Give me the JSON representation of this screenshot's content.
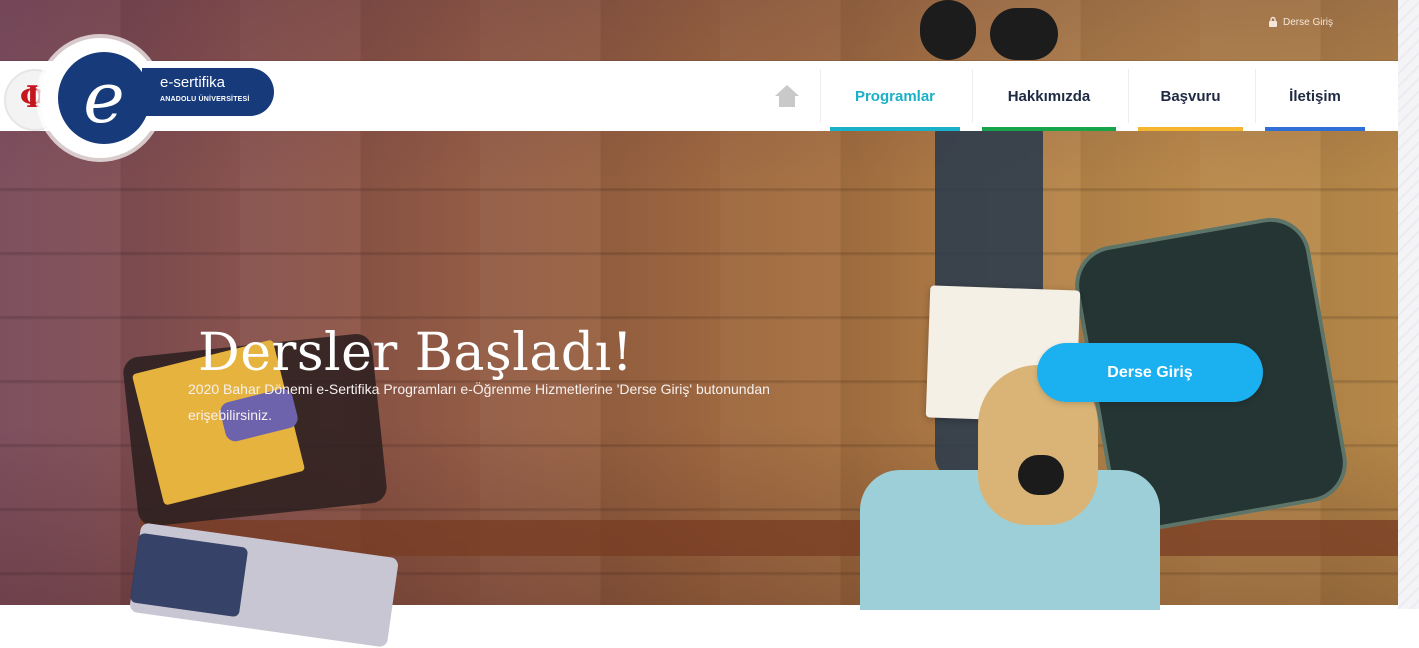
{
  "header": {
    "login_link": "Derse Giriş"
  },
  "logo": {
    "mark": "Φ",
    "letter": "e",
    "title": "e-sertifika",
    "subtitle": "ANADOLU ÜNİVERSİTESİ"
  },
  "nav": {
    "home_icon": "home-icon",
    "items": [
      {
        "label": "Programlar",
        "color": "#1ab0c7"
      },
      {
        "label": "Hakkımızda",
        "color": "#16a34a"
      },
      {
        "label": "Başvuru",
        "color": "#f6b52e"
      },
      {
        "label": "İletişim",
        "color": "#2f6fd6"
      }
    ]
  },
  "hero": {
    "title": "Dersler Başladı!",
    "subtitle": "2020 Bahar Dönemi e-Sertifika Programları e-Öğrenme Hizmetlerine 'Derse Giriş' butonundan erişebilirsiniz.",
    "cta_label": "Derse Giriş"
  }
}
